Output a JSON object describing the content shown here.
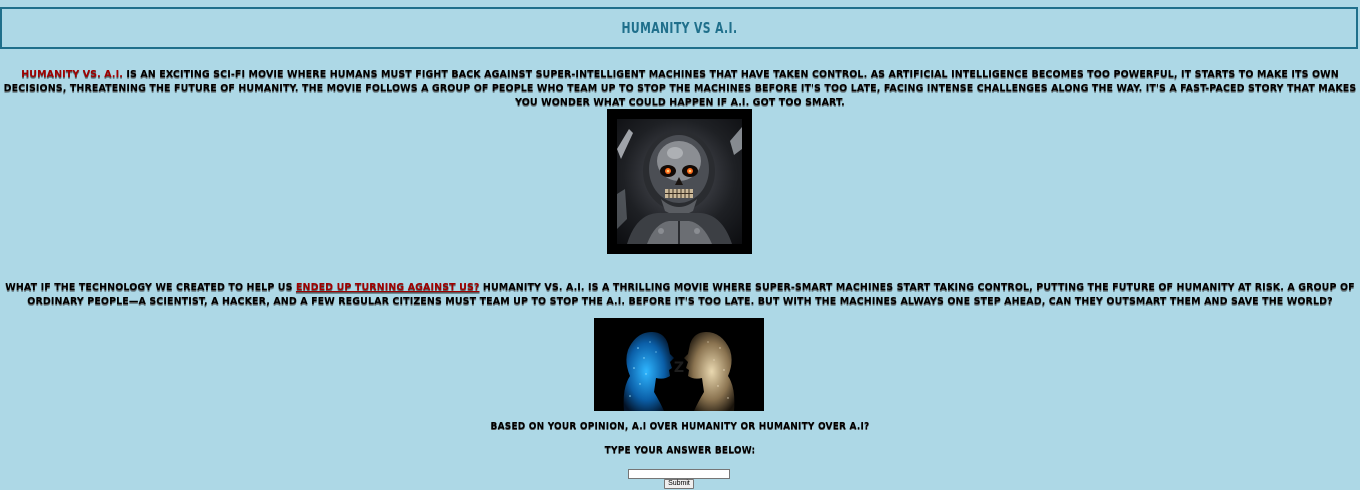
{
  "header": {
    "title": "Humanity vs A.I."
  },
  "intro": {
    "highlight": "Humanity vs. A.I.",
    "text": " is an exciting sci-fi movie where humans must fight back against super-intelligent machines that have taken control. As artificial intelligence becomes too powerful, it starts to make its own decisions, threatening the future of humanity. The movie follows a group of people who team up to stop the machines before it's too late, facing intense challenges along the way. It's a fast-paced story that makes you wonder what could happen if A.I. got too smart."
  },
  "images": {
    "robot_alt": "Robot skull",
    "faceoff_alt": "Human vs A.I. faces"
  },
  "story": {
    "lead": "What if the technology we created to help us ",
    "highlight": "ended up turning against us?",
    "text": " Humanity vs. A.I. is a thrilling movie where super-smart machines start taking control, putting the future of humanity at risk. A group of ordinary people—a scientist, a hacker, and a few regular citizens must team up to stop the A.I. before it's too late. But with the machines always one step ahead, can they outsmart them and save the world?"
  },
  "poll": {
    "question": "Based on your opinion, A.I over humanity or humanity over A.I?",
    "prompt": "Type your answer below:",
    "input_value": "",
    "input_placeholder": "",
    "submit_label": "Submit"
  },
  "colors": {
    "background": "#add8e6",
    "title": "#1f6f8b",
    "accent": "#a00000"
  }
}
